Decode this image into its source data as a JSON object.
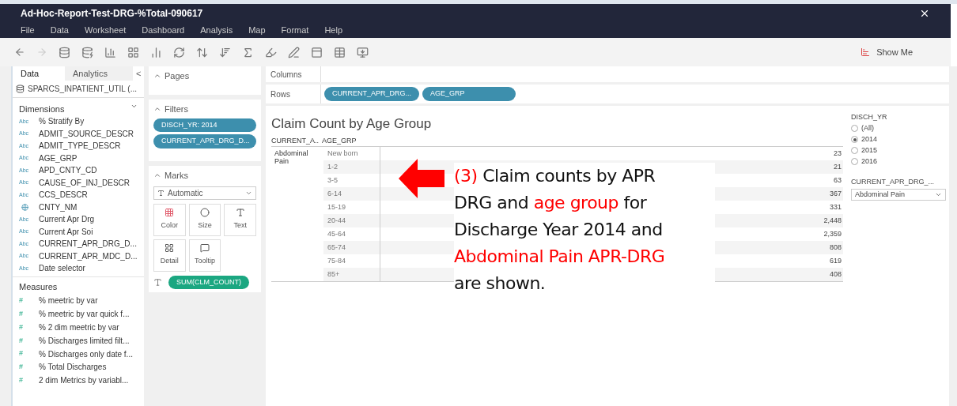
{
  "window": {
    "title": "Ad-Hoc-Report-Test-DRG-%Total-090617"
  },
  "menu": [
    "File",
    "Data",
    "Worksheet",
    "Dashboard",
    "Analysis",
    "Map",
    "Format",
    "Help"
  ],
  "toolbar": {
    "show_me": "Show Me"
  },
  "side_tabs": [
    {
      "label": "Data",
      "selected": true
    },
    {
      "label": "Analytics",
      "selected": false
    }
  ],
  "collapse": "<",
  "data_source": "SPARCS_INPATIENT_UTIL (...",
  "dimensions": {
    "title": "Dimensions",
    "items": [
      {
        "kind": "text",
        "type": "Abc",
        "label": "% Stratify By"
      },
      {
        "kind": "text",
        "type": "Abc",
        "label": "ADMIT_SOURCE_DESCR"
      },
      {
        "kind": "text",
        "type": "Abc",
        "label": "ADMIT_TYPE_DESCR"
      },
      {
        "kind": "text",
        "type": "Abc",
        "label": "AGE_GRP"
      },
      {
        "kind": "text",
        "type": "Abc",
        "label": "APD_CNTY_CD"
      },
      {
        "kind": "text",
        "type": "Abc",
        "label": "CAUSE_OF_INJ_DESCR"
      },
      {
        "kind": "text",
        "type": "Abc",
        "label": "CCS_DESCR"
      },
      {
        "kind": "geo",
        "label": "CNTY_NM"
      },
      {
        "kind": "text",
        "type": "Abc",
        "label": "Current Apr Drg"
      },
      {
        "kind": "text",
        "type": "Abc",
        "label": "Current Apr Soi"
      },
      {
        "kind": "text",
        "type": "Abc",
        "label": "CURRENT_APR_DRG_D..."
      },
      {
        "kind": "text",
        "type": "Abc",
        "label": "CURRENT_APR_MDC_D..."
      },
      {
        "kind": "text",
        "type": "Abc",
        "label": "Date selector"
      }
    ]
  },
  "measures": {
    "title": "Measures",
    "items": [
      {
        "type": "#",
        "label": "% meetric by var"
      },
      {
        "type": "#",
        "label": "% meetric by var quick f..."
      },
      {
        "type": "#",
        "label": "% 2 dim meetric by var"
      },
      {
        "type": "#",
        "label": "% Discharges limited filt..."
      },
      {
        "type": "#",
        "label": "% Discharges only date f..."
      },
      {
        "type": "#",
        "label": "% Total Discharges"
      },
      {
        "type": "#",
        "label": "2 dim Metrics by variabl..."
      }
    ]
  },
  "pages": {
    "title": "Pages"
  },
  "filters": {
    "title": "Filters",
    "pills": [
      "DISCH_YR: 2014",
      "CURRENT_APR_DRG_D..."
    ]
  },
  "marks": {
    "title": "Marks",
    "type": "Automatic",
    "cards": [
      {
        "kind": "color",
        "label": "Color"
      },
      {
        "kind": "size",
        "label": "Size"
      },
      {
        "kind": "text",
        "label": "Text"
      },
      {
        "kind": "detail",
        "label": "Detail"
      },
      {
        "kind": "tooltip",
        "label": "Tooltip"
      }
    ],
    "pill": "SUM(CLM_COUNT)"
  },
  "columns_shelf": {
    "label": "Columns"
  },
  "rows_shelf": {
    "label": "Rows",
    "pills": [
      "CURRENT_APR_DRG...",
      "AGE_GRP"
    ]
  },
  "sheet": {
    "title": "Claim Count by Age Group",
    "headers": [
      "CURRENT_A..",
      "AGE_GRP"
    ],
    "group": "Abdominal Pain",
    "rows": [
      {
        "age": "New born",
        "value": "23"
      },
      {
        "age": "1-2",
        "value": "21"
      },
      {
        "age": "3-5",
        "value": "63"
      },
      {
        "age": "6-14",
        "value": "367"
      },
      {
        "age": "15-19",
        "value": "331"
      },
      {
        "age": "20-44",
        "value": "2,448"
      },
      {
        "age": "45-64",
        "value": "2,359"
      },
      {
        "age": "65-74",
        "value": "808"
      },
      {
        "age": "75-84",
        "value": "619"
      },
      {
        "age": "85+",
        "value": "408"
      }
    ]
  },
  "year_filter": {
    "title": "DISCH_YR",
    "options": [
      {
        "label": "(All)",
        "selected": false
      },
      {
        "label": "2014",
        "selected": true
      },
      {
        "label": "2015",
        "selected": false
      },
      {
        "label": "2016",
        "selected": false
      }
    ]
  },
  "drg_filter": {
    "title": "CURRENT_APR_DRG_...",
    "value": "Abdominal Pain"
  },
  "annotation": {
    "lines": [
      [
        {
          "text": "(3)",
          "emphasis": true
        },
        {
          "text": " Claim counts by APR",
          "emphasis": false
        }
      ],
      [
        {
          "text": "DRG and ",
          "emphasis": false
        },
        {
          "text": "age group",
          "emphasis": true
        },
        {
          "text": " for",
          "emphasis": false
        }
      ],
      [
        {
          "text": "Discharge Year 2014 and",
          "emphasis": false
        }
      ],
      [
        {
          "text": "Abdominal Pain APR-DRG",
          "emphasis": true
        }
      ],
      [
        {
          "text": "are shown.",
          "emphasis": false
        }
      ]
    ]
  }
}
